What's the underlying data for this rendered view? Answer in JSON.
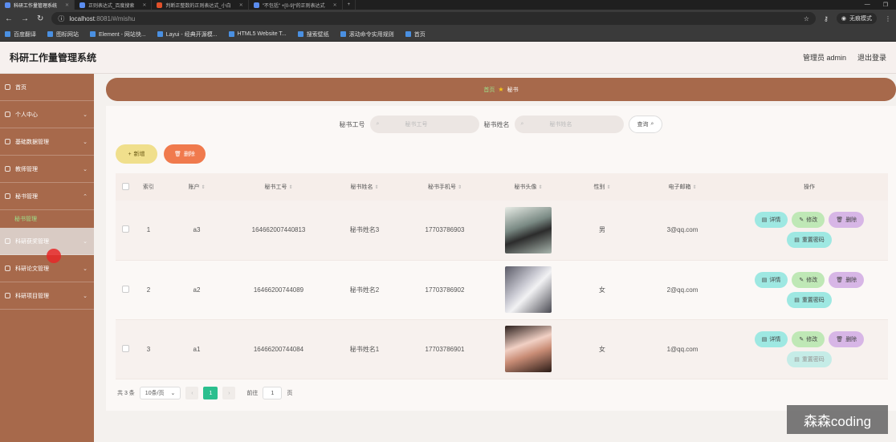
{
  "browser": {
    "tabs": [
      {
        "title": "科研工作量管理系统",
        "active": true
      },
      {
        "title": "正则表达式_百度搜索",
        "active": false
      },
      {
        "title": "判断正整数的正则表达式_小白",
        "active": false
      },
      {
        "title": "\"不包括\" +[0-9]*的正则表达式",
        "active": false
      }
    ],
    "url_host": "localhost",
    "url_rest": ":8081/#/mishu",
    "incognito_label": "无痕模式",
    "bookmarks": [
      "百度翻译",
      "图标网站",
      "Element - 网站快...",
      "Layui - 经典开源模...",
      "HTML5 Website T...",
      "搜索壁纸",
      "滚动命令实用规则",
      "首页"
    ]
  },
  "header": {
    "title": "科研工作量管理系统",
    "user": "管理员 admin",
    "logout": "退出登录"
  },
  "sidebar": {
    "items": [
      {
        "label": "首页"
      },
      {
        "label": "个人中心"
      },
      {
        "label": "基础数据管理"
      },
      {
        "label": "教师管理"
      },
      {
        "label": "秘书管理"
      },
      {
        "label": "科研获奖管理"
      },
      {
        "label": "科研论文管理"
      },
      {
        "label": "科研项目管理"
      }
    ],
    "active_sub": "秘书管理"
  },
  "breadcrumb": {
    "home": "首页",
    "current": "秘书"
  },
  "search": {
    "label_id": "秘书工号",
    "placeholder_id": "秘书工号",
    "label_name": "秘书姓名",
    "placeholder_name": "秘书姓名",
    "button": "查询"
  },
  "actions": {
    "add": "新增",
    "delete": "删除"
  },
  "table": {
    "headers": [
      "索引",
      "账户",
      "秘书工号",
      "秘书姓名",
      "秘书手机号",
      "秘书头像",
      "性别",
      "电子邮箱",
      "操作"
    ],
    "rows": [
      {
        "index": "1",
        "account": "a3",
        "id": "164662007440813",
        "name": "秘书姓名3",
        "phone": "17703786903",
        "gender": "男",
        "email": "3@qq.com"
      },
      {
        "index": "2",
        "account": "a2",
        "id": "16466200744089",
        "name": "秘书姓名2",
        "phone": "17703786902",
        "gender": "女",
        "email": "2@qq.com"
      },
      {
        "index": "3",
        "account": "a1",
        "id": "16466200744084",
        "name": "秘书姓名1",
        "phone": "17703786901",
        "gender": "女",
        "email": "1@qq.com"
      }
    ],
    "op_labels": {
      "detail": "详情",
      "edit": "修改",
      "delete": "删除",
      "reset": "重置密码"
    }
  },
  "pagination": {
    "total": "共 3 条",
    "page_size": "10条/页",
    "current_page": "1",
    "goto_prefix": "前往",
    "goto_value": "1",
    "goto_suffix": "页"
  },
  "watermark": "森森coding"
}
